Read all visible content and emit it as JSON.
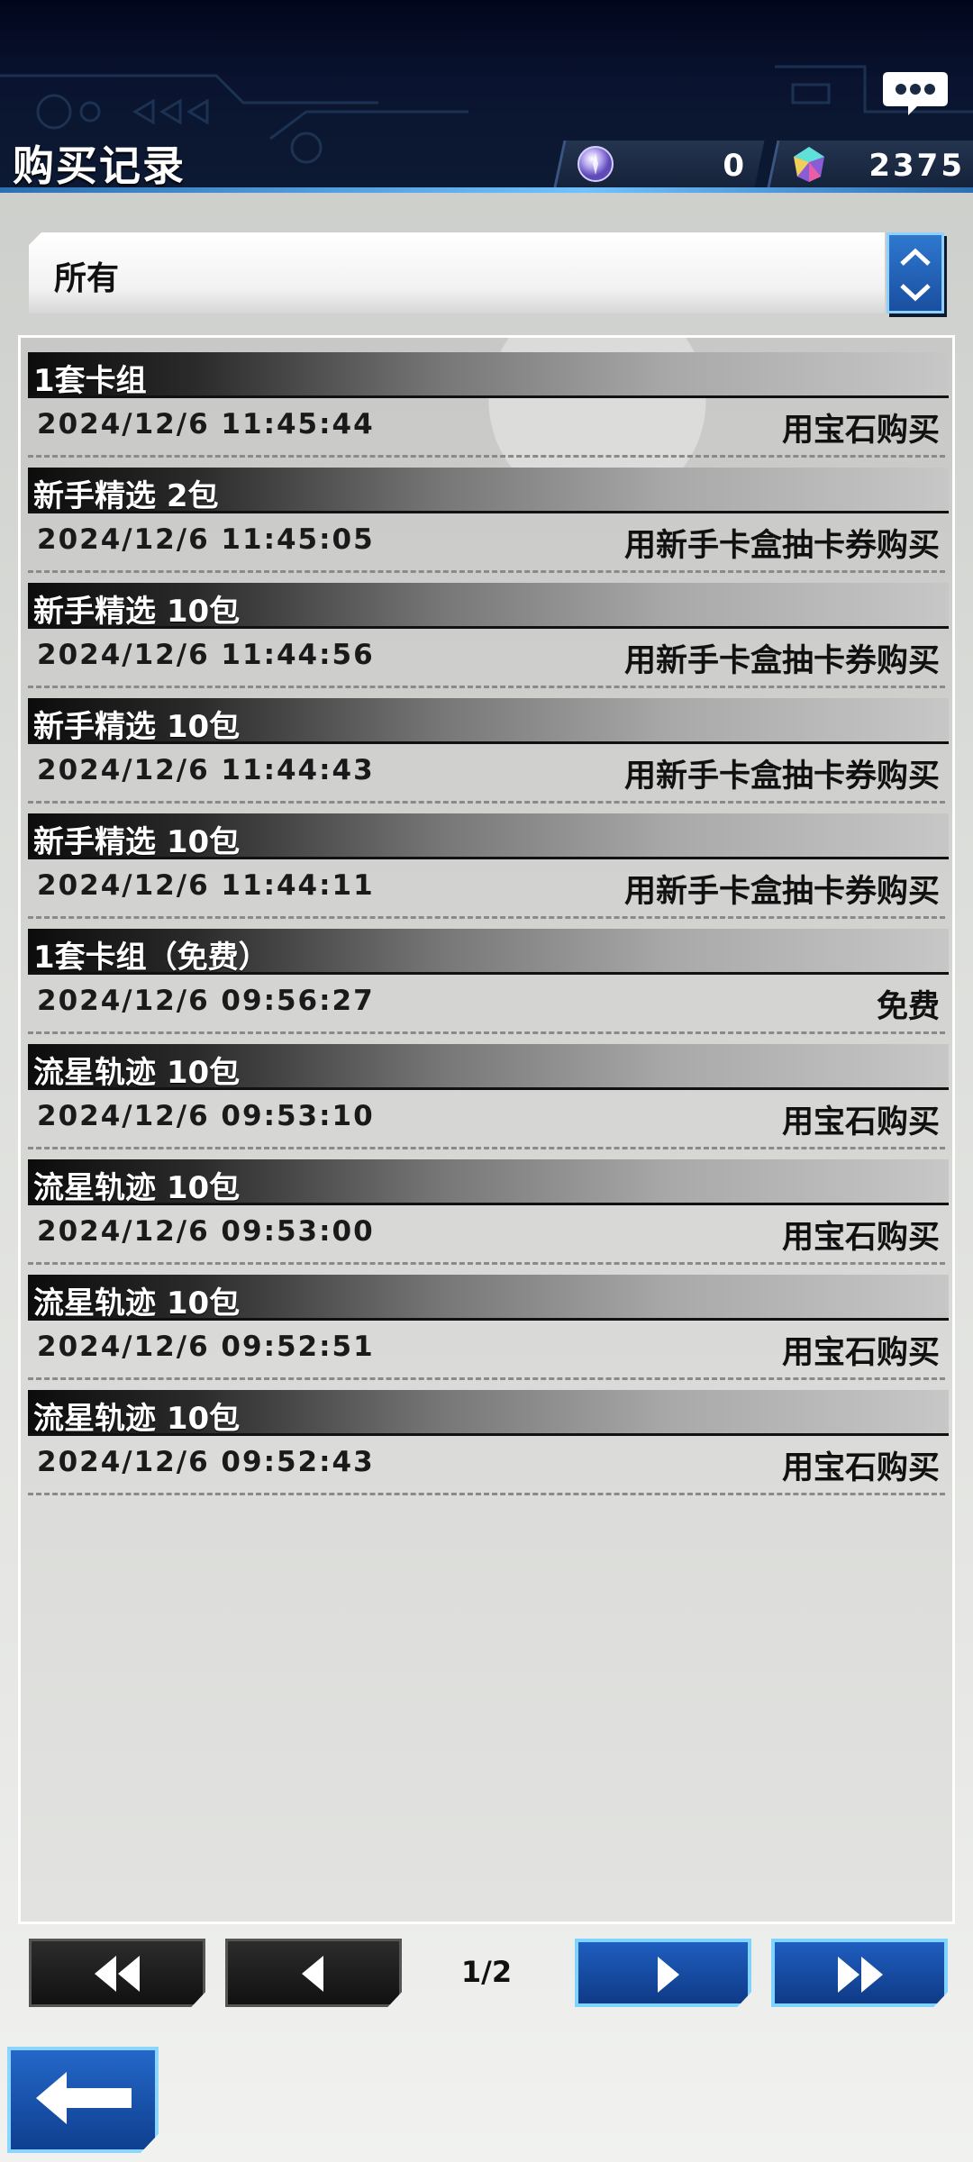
{
  "header": {
    "title": "购买记录",
    "chat_icon": "chat-bubble-icon",
    "currencies": [
      {
        "icon": "orb-icon",
        "value": "0"
      },
      {
        "icon": "gem-icon",
        "value": "2375"
      }
    ]
  },
  "filter": {
    "selected": "所有",
    "arrows_icon": "up-down-arrows-icon"
  },
  "records": [
    {
      "title": "1套卡组",
      "date": "2024/12/6 11:45:44",
      "method": "用宝石购买"
    },
    {
      "title": "新手精选 2包",
      "date": "2024/12/6 11:45:05",
      "method": "用新手卡盒抽卡券购买"
    },
    {
      "title": "新手精选 10包",
      "date": "2024/12/6 11:44:56",
      "method": "用新手卡盒抽卡券购买"
    },
    {
      "title": "新手精选 10包",
      "date": "2024/12/6 11:44:43",
      "method": "用新手卡盒抽卡券购买"
    },
    {
      "title": "新手精选 10包",
      "date": "2024/12/6 11:44:11",
      "method": "用新手卡盒抽卡券购买"
    },
    {
      "title": "1套卡组（免费）",
      "date": "2024/12/6 09:56:27",
      "method": "免费"
    },
    {
      "title": "流星轨迹 10包",
      "date": "2024/12/6 09:53:10",
      "method": "用宝石购买"
    },
    {
      "title": "流星轨迹 10包",
      "date": "2024/12/6 09:53:00",
      "method": "用宝石购买"
    },
    {
      "title": "流星轨迹 10包",
      "date": "2024/12/6 09:52:51",
      "method": "用宝石购买"
    },
    {
      "title": "流星轨迹 10包",
      "date": "2024/12/6 09:52:43",
      "method": "用宝石购买"
    }
  ],
  "pager": {
    "page_label": "1/2",
    "first_icon": "double-left-arrow-icon",
    "prev_icon": "left-arrow-icon",
    "next_icon": "right-arrow-icon",
    "last_icon": "double-right-arrow-icon"
  },
  "back_icon": "back-arrow-icon",
  "colors": {
    "header_bg": "#0a1430",
    "accent_blue": "#1f5ec0",
    "accent_cyan": "#7fd3ff",
    "panel_bg": "#d6d7d4"
  }
}
